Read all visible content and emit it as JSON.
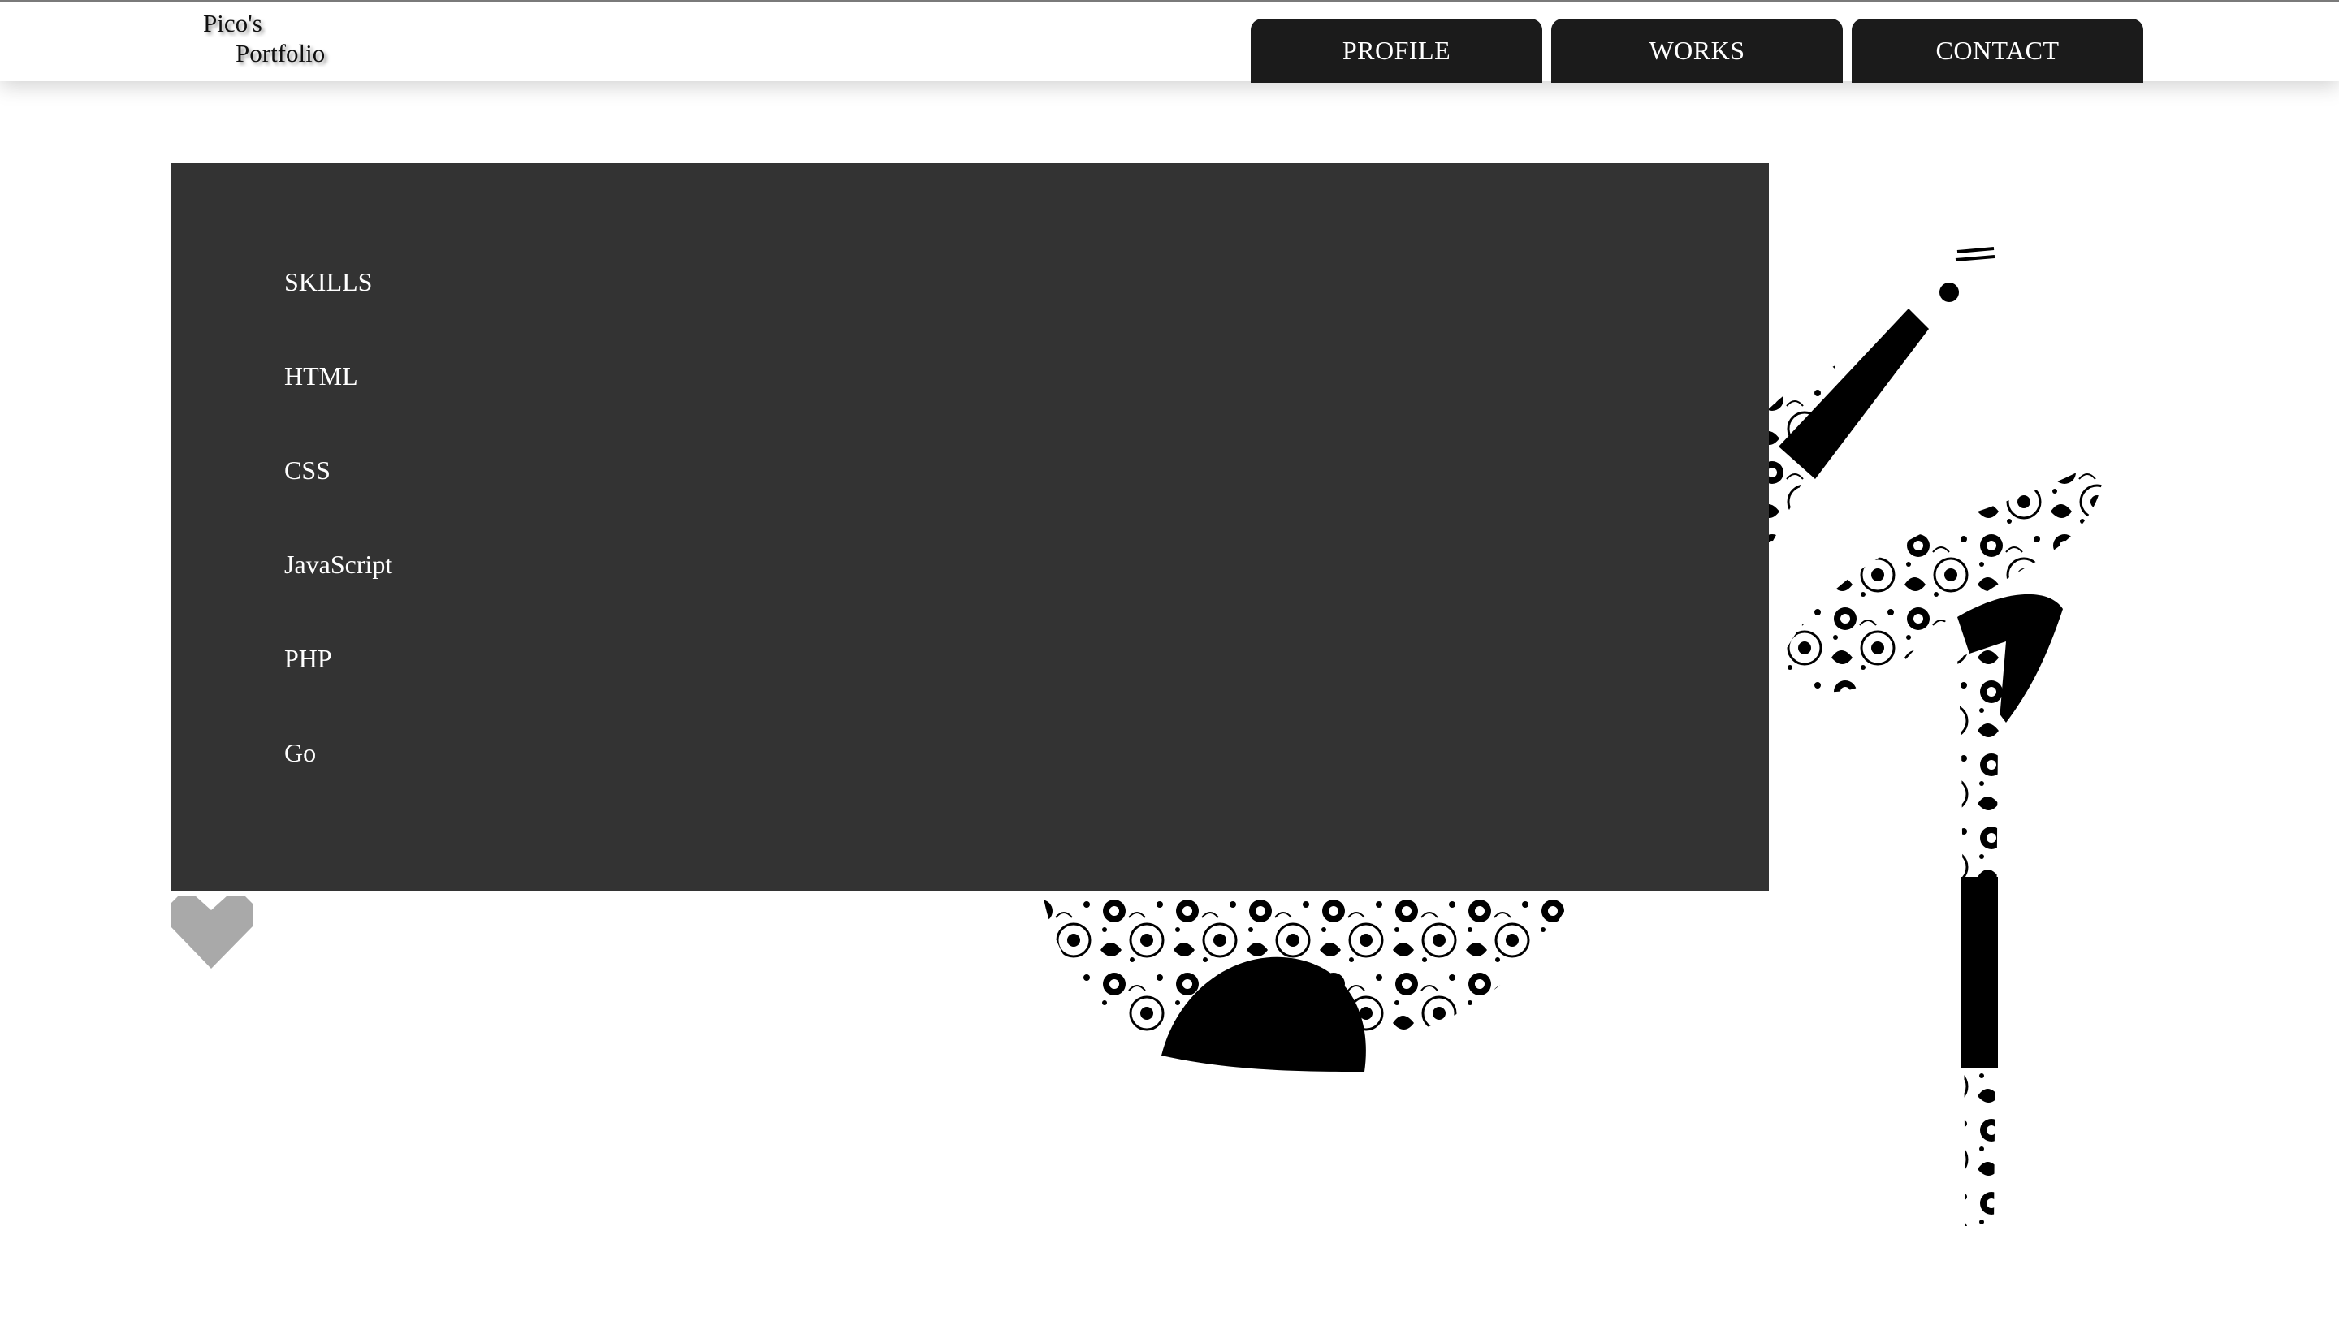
{
  "logo": {
    "line1": "Pico's",
    "line2": "Portfolio"
  },
  "nav": {
    "items": [
      "PROFILE",
      "WORKS",
      "CONTACT"
    ]
  },
  "skills": {
    "heading": "SKILLS",
    "items": [
      "HTML",
      "CSS",
      "JavaScript",
      "PHP",
      "Go"
    ]
  },
  "icons": {
    "like": "heart-icon",
    "illustration": "high-heel-shoe-illustration"
  },
  "colors": {
    "panel": "#333333",
    "nav_button": "#1b1b1b",
    "heart": "#a9a9a9",
    "text_light": "#ffffff"
  }
}
